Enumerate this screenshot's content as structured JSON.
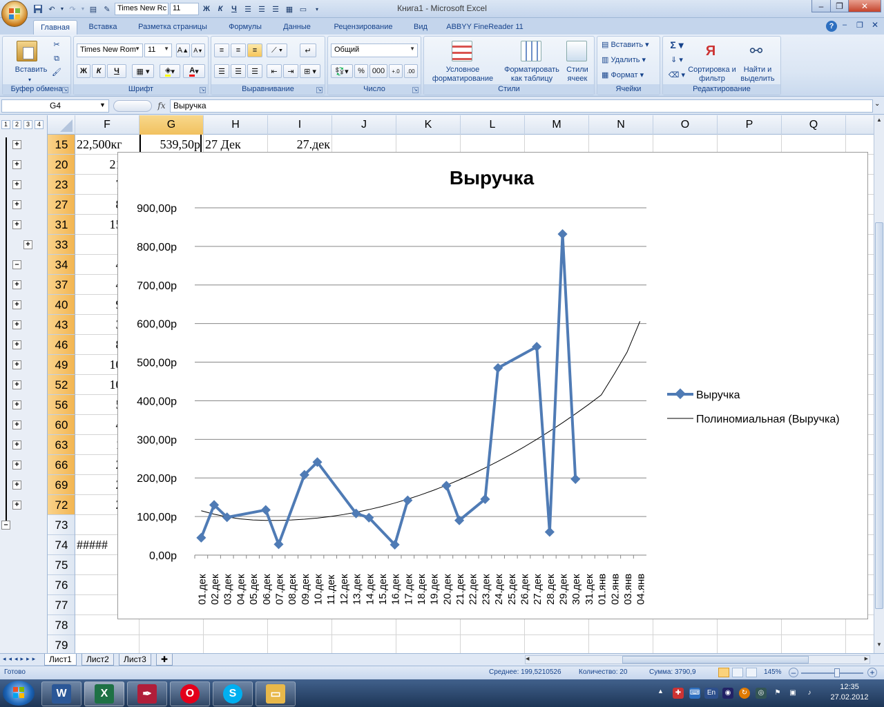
{
  "window": {
    "title": "Книга1 - Microsoft Excel",
    "qat_font": "Times New Rc",
    "qat_size": "11",
    "qat_bold": "Ж",
    "qat_italic": "К"
  },
  "tabs": [
    "Главная",
    "Вставка",
    "Разметка страницы",
    "Формулы",
    "Данные",
    "Рецензирование",
    "Вид",
    "ABBYY FineReader 11"
  ],
  "ribbon": {
    "clipboard": {
      "label": "Буфер обмена",
      "paste": "Вставить"
    },
    "font": {
      "label": "Шрифт",
      "name": "Times New Rom",
      "size": "11",
      "bold": "Ж",
      "italic": "К",
      "underline": "Ч"
    },
    "alignment": {
      "label": "Выравнивание"
    },
    "number": {
      "label": "Число",
      "format": "Общий",
      "percent": "%",
      "thousands": "000"
    },
    "styles": {
      "label": "Стили",
      "conditional": "Условное форматирование",
      "as_table": "Форматировать как таблицу",
      "cell_styles": "Стили ячеек"
    },
    "cells": {
      "label": "Ячейки",
      "insert": "Вставить",
      "delete": "Удалить",
      "format": "Формат"
    },
    "editing": {
      "label": "Редактирование",
      "sort": "Сортировка и фильтр",
      "find": "Найти и выделить"
    }
  },
  "formula_bar": {
    "name_box": "G4",
    "fx": "fx",
    "formula": "Выручка"
  },
  "outline_levels": [
    "1",
    "2",
    "3",
    "4"
  ],
  "columns": [
    "F",
    "G",
    "H",
    "I",
    "J",
    "K",
    "L",
    "M",
    "N",
    "O",
    "P",
    "Q"
  ],
  "rows": [
    {
      "num": "15",
      "f": "22,500кг",
      "g": "539,50р",
      "h": "27 Дек",
      "i": "27.дек"
    },
    {
      "num": "20",
      "f": "21,00"
    },
    {
      "num": "23",
      "f": "7,00"
    },
    {
      "num": "27",
      "f": "8,00"
    },
    {
      "num": "31",
      "f": "15,00"
    },
    {
      "num": "33",
      "f": ""
    },
    {
      "num": "34",
      "f": "4,80"
    },
    {
      "num": "37",
      "f": "4,00"
    },
    {
      "num": "40",
      "f": "9,50"
    },
    {
      "num": "43",
      "f": "3,50"
    },
    {
      "num": "46",
      "f": "8,50"
    },
    {
      "num": "49",
      "f": "10,00"
    },
    {
      "num": "52",
      "f": "10,00"
    },
    {
      "num": "56",
      "f": "5,00"
    },
    {
      "num": "60",
      "f": "4,00"
    },
    {
      "num": "63",
      "f": "1,50"
    },
    {
      "num": "66",
      "f": "2,50"
    },
    {
      "num": "69",
      "f": "2,00"
    },
    {
      "num": "72",
      "f": "2,00"
    },
    {
      "num": "73",
      "f": ""
    },
    {
      "num": "74",
      "f": "#####"
    },
    {
      "num": "75",
      "f": ""
    },
    {
      "num": "76",
      "f": ""
    },
    {
      "num": "77",
      "f": ""
    },
    {
      "num": "78",
      "f": ""
    },
    {
      "num": "79",
      "f": ""
    }
  ],
  "sheets": [
    "Лист1",
    "Лист2",
    "Лист3"
  ],
  "status": {
    "ready": "Готово",
    "average": "Среднее: 199,5210526",
    "count": "Количество: 20",
    "sum": "Сумма: 3790,9",
    "zoom": "145%"
  },
  "taskbar": {
    "time": "12:35",
    "date": "27.02.2012",
    "lang": "En"
  },
  "chart_data": {
    "type": "line",
    "title": "Выручка",
    "categories": [
      "01.дек",
      "02.дек",
      "03.дек",
      "04.дек",
      "05.дек",
      "06.дек",
      "07.дек",
      "08.дек",
      "09.дек",
      "10.дек",
      "11.дек",
      "12.дек",
      "13.дек",
      "14.дек",
      "15.дек",
      "16.дек",
      "17.дек",
      "18.дек",
      "19.дек",
      "20.дек",
      "21.дек",
      "22.дек",
      "23.дек",
      "24.дек",
      "25.дек",
      "26.дек",
      "27.дек",
      "28.дек",
      "29.дек",
      "30.дек",
      "31.дек",
      "01.янв",
      "02.янв",
      "03.янв",
      "04.янв"
    ],
    "series": [
      {
        "name": "Выручка",
        "color": "#4f7bb5",
        "points": [
          [
            0,
            45
          ],
          [
            1,
            130
          ],
          [
            2,
            98
          ],
          [
            5,
            117
          ],
          [
            6,
            28
          ],
          [
            8,
            208
          ],
          [
            9,
            241
          ],
          [
            12,
            108
          ],
          [
            13,
            97
          ],
          [
            15,
            27
          ],
          [
            16,
            142
          ],
          [
            19,
            180
          ],
          [
            20,
            90
          ],
          [
            22,
            145
          ],
          [
            23,
            485
          ],
          [
            26,
            540
          ],
          [
            27,
            60
          ],
          [
            28,
            832
          ],
          [
            29,
            197
          ]
        ]
      }
    ],
    "trendline": {
      "name": "Полиномиальная (Выручка)",
      "color": "#000000",
      "values": [
        115,
        106,
        99,
        94,
        91,
        90,
        90,
        91,
        93,
        96,
        100,
        105,
        111,
        118,
        126,
        135,
        145,
        156,
        168,
        181,
        195,
        210,
        226,
        243,
        261,
        280,
        300,
        321,
        343,
        366,
        390,
        415,
        469,
        526,
        606
      ]
    },
    "y_ticks": [
      "0,00р",
      "100,00р",
      "200,00р",
      "300,00р",
      "400,00р",
      "500,00р",
      "600,00р",
      "700,00р",
      "800,00р",
      "900,00р"
    ],
    "ylim": [
      0,
      900
    ],
    "grid": true,
    "legend": "right"
  }
}
